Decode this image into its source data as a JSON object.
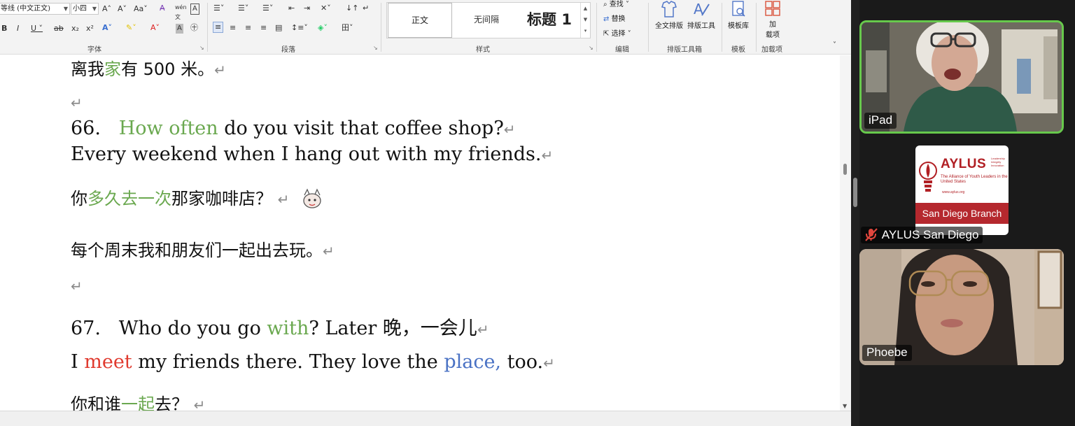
{
  "ribbon": {
    "font_name": "等线 (中文正文)",
    "font_size": "小四",
    "font_group": "字体",
    "paragraph_group": "段落",
    "styles_group": "样式",
    "styles": [
      "正文",
      "无间隔",
      "标题 1"
    ],
    "editing_group": "编辑",
    "find": "查找",
    "replace": "替换",
    "select": "选择",
    "full_layout": "全文排版",
    "layout_tool": "排版工具",
    "layout_toolbox_group": "排版工具箱",
    "template_lib": "模板库",
    "template_group": "模板",
    "addins_line1": "加",
    "addins_line2": "载项",
    "addins_group": "加载项"
  },
  "document": {
    "para_mark": "↵",
    "lines": {
      "l1_a": "离我",
      "l1_b": "家",
      "l1_c": "有 500 米。",
      "l3_num": "66.",
      "l3_g": "How often",
      "l3_rest": " do you visit that coffee shop?",
      "l4": "Every weekend when I hang out with my friends.",
      "l5_a": "你",
      "l5_g": "多久去一次",
      "l5_c": "那家咖啡店？",
      "l6": "每个周末我和朋友们一起出去玩。",
      "l8_num": "67.",
      "l8_a": "Who do you go ",
      "l8_g": "with",
      "l8_c": "? Later 晚，一会儿",
      "l9_a": "I ",
      "l9_r": "meet",
      "l9_b": " my friends there. They love the ",
      "l9_blue": "place,",
      "l9_c": " too.",
      "l10_a": "你和谁",
      "l10_g": "一起",
      "l10_c": "去？"
    }
  },
  "zoom": {
    "participants": [
      {
        "name": "iPad",
        "active_speaker": true
      },
      {
        "name": "AYLUS San Diego",
        "muted": true
      },
      {
        "name": "Phoebe"
      }
    ],
    "aylus_logo": {
      "title": "AYLUS",
      "subtitle": "The Alliance of Youth Leaders in the United States",
      "small": "Leadership Integrity Innovation",
      "url": "www.aylus.org",
      "band": "San Diego Branch"
    }
  },
  "colors": {
    "green": "#6aa84f",
    "red": "#e03a2e",
    "blue": "#4a72c4",
    "active_border": "#67c94c",
    "aylus_red": "#b5282e"
  }
}
